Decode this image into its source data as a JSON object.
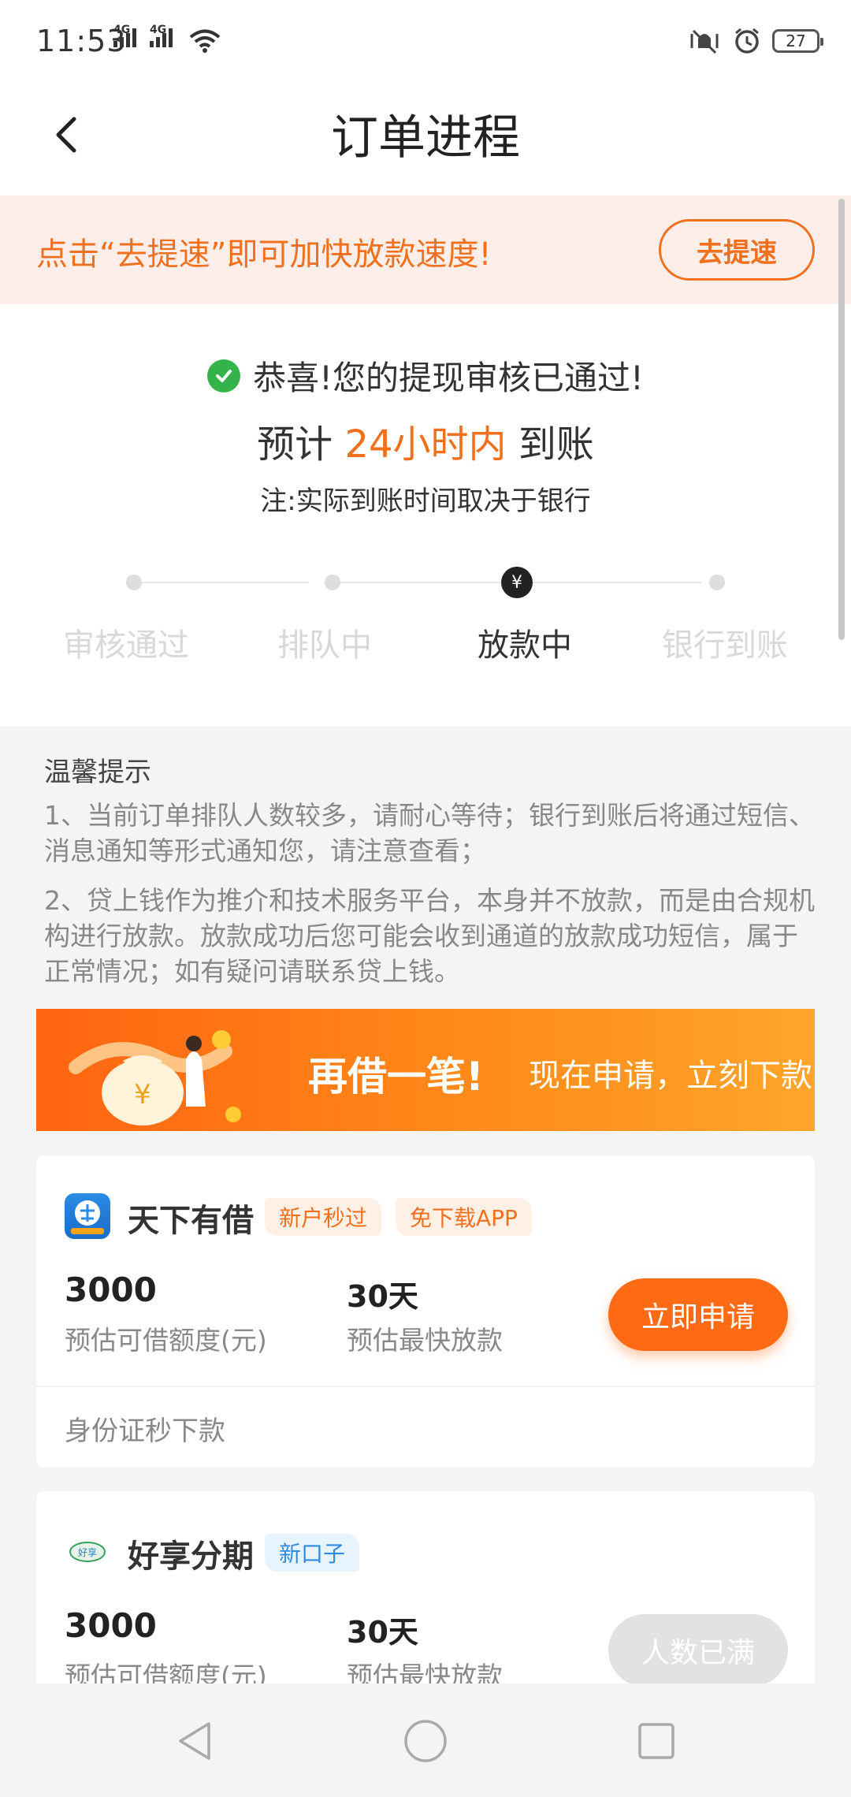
{
  "status_bar": {
    "time": "11:53",
    "signal1": "4G",
    "signal2": "4G",
    "battery": "27"
  },
  "header": {
    "title": "订单进程"
  },
  "promo": {
    "text": "点击“去提速”即可加快放款速度!",
    "button": "去提速"
  },
  "status": {
    "approved": "恭喜!您的提现审核已通过!",
    "eta_prefix": "预计",
    "eta_highlight": "24小时内",
    "eta_suffix": "到账",
    "note": "注:实际到账时间取决于银行"
  },
  "steps": [
    {
      "label": "审核通过",
      "active": false
    },
    {
      "label": "排队中",
      "active": false
    },
    {
      "label": "放款中",
      "active": true
    },
    {
      "label": "银行到账",
      "active": false
    }
  ],
  "yen_symbol": "¥",
  "tips": {
    "title": "温馨提示",
    "items": [
      "1、当前订单排队人数较多，请耐心等待；银行到账后将通过短信、消息通知等形式通知您，请注意查看；",
      "2、贷上钱作为推介和技术服务平台，本身并不放款，而是由合规机构进行放款。放款成功后您可能会收到通道的放款成功短信，属于正常情况；如有疑问请联系贷上钱。"
    ]
  },
  "ad_banner": {
    "title": "再借一笔!",
    "subtitle": "现在申请，立刻下款"
  },
  "loans": [
    {
      "name": "天下有借",
      "tags": [
        "新户秒过",
        "免下载APP"
      ],
      "amount": "3000",
      "amount_label": "预估可借额度(元)",
      "days": "30天",
      "days_label": "预估最快放款",
      "button": "立即申请",
      "footer": "身份证秒下款"
    },
    {
      "name": "好享分期",
      "tags": [
        "新口子"
      ],
      "amount": "3000",
      "amount_label": "预估可借额度(元)",
      "days": "30天",
      "days_label": "预估最快放款",
      "button": "人数已满"
    }
  ],
  "colors": {
    "accent": "#f0701e",
    "button": "#ff6a14",
    "success": "#34b34a",
    "promo_bg": "#fdeeea"
  }
}
